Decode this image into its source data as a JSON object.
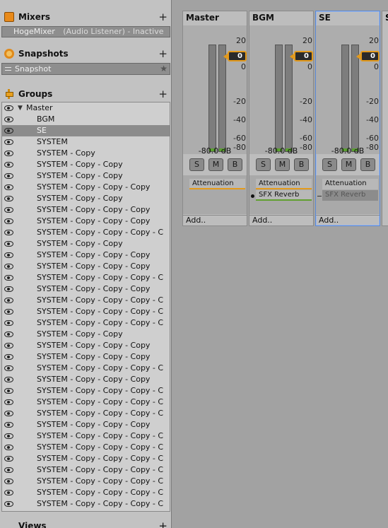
{
  "mixers": {
    "title": "Mixers",
    "add": "+",
    "item_name": "HogeMixer",
    "item_status": "(Audio Listener) - Inactive"
  },
  "snapshots": {
    "title": "Snapshots",
    "add": "+",
    "item": "Snapshot",
    "star": "★"
  },
  "groups": {
    "title": "Groups",
    "add": "+",
    "items": [
      "Master",
      "BGM",
      "SE",
      "SYSTEM",
      "SYSTEM - Copy",
      "SYSTEM - Copy - Copy",
      "SYSTEM - Copy - Copy",
      "SYSTEM - Copy - Copy - Copy",
      "SYSTEM - Copy - Copy",
      "SYSTEM - Copy - Copy - Copy",
      "SYSTEM - Copy - Copy - Copy",
      "SYSTEM - Copy - Copy - Copy - C",
      "SYSTEM - Copy - Copy",
      "SYSTEM - Copy - Copy - Copy",
      "SYSTEM - Copy - Copy - Copy",
      "SYSTEM - Copy - Copy - Copy - C",
      "SYSTEM - Copy - Copy - Copy",
      "SYSTEM - Copy - Copy - Copy - C",
      "SYSTEM - Copy - Copy - Copy - C",
      "SYSTEM - Copy - Copy - Copy - C",
      "SYSTEM - Copy - Copy",
      "SYSTEM - Copy - Copy - Copy",
      "SYSTEM - Copy - Copy - Copy",
      "SYSTEM - Copy - Copy - Copy - C",
      "SYSTEM - Copy - Copy - Copy",
      "SYSTEM - Copy - Copy - Copy - C",
      "SYSTEM - Copy - Copy - Copy - C",
      "SYSTEM - Copy - Copy - Copy - C",
      "SYSTEM - Copy - Copy - Copy",
      "SYSTEM - Copy - Copy - Copy - C",
      "SYSTEM - Copy - Copy - Copy - C",
      "SYSTEM - Copy - Copy - Copy - C",
      "SYSTEM - Copy - Copy - Copy - C",
      "SYSTEM - Copy - Copy - Copy - C",
      "SYSTEM - Copy - Copy - Copy - C",
      "SYSTEM - Copy - Copy - Copy - C"
    ],
    "selected_index": 2
  },
  "views": {
    "title": "Views",
    "add": "+"
  },
  "strips": [
    {
      "name": "Master",
      "fader": "0",
      "db": "-80.0 dB",
      "solo": "S",
      "mute": "M",
      "bypass": "B",
      "effects": [
        {
          "label": "Attenuation",
          "kind": "att"
        }
      ],
      "add": "Add..",
      "selected": false
    },
    {
      "name": "BGM",
      "fader": "0",
      "db": "-80.0 dB",
      "solo": "S",
      "mute": "M",
      "bypass": "B",
      "effects": [
        {
          "label": "Attenuation",
          "kind": "att"
        },
        {
          "label": "SFX Reverb",
          "kind": "rev"
        }
      ],
      "add": "Add..",
      "selected": false
    },
    {
      "name": "SE",
      "fader": "0",
      "db": "-80.0 dB",
      "solo": "S",
      "mute": "M",
      "bypass": "B",
      "effects": [
        {
          "label": "Attenuation",
          "kind": "plain"
        },
        {
          "label": "SFX Reverb",
          "kind": "byp"
        }
      ],
      "add": "Add..",
      "selected": true
    }
  ],
  "partial_strip": {
    "name": "S"
  },
  "meter_scale": [
    "20",
    "0",
    "-20",
    "-40",
    "-60",
    "-80"
  ],
  "colors": {
    "accent": "#e39a1c",
    "reverb": "#60a030",
    "selection": "#5a8ad8"
  }
}
